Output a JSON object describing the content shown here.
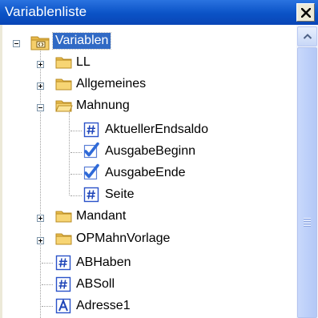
{
  "window": {
    "title": "Variablenliste"
  },
  "tree": {
    "root": {
      "label": "Variablen",
      "expanded": true,
      "selected": true,
      "icon": "folder-struct-icon"
    },
    "items": [
      {
        "label": "LL",
        "icon": "folder-icon",
        "expandable": true,
        "expanded": false,
        "level": 1
      },
      {
        "label": "Allgemeines",
        "icon": "folder-icon",
        "expandable": true,
        "expanded": false,
        "level": 1
      },
      {
        "label": "Mahnung",
        "icon": "folder-open-icon",
        "expandable": true,
        "expanded": true,
        "level": 1
      },
      {
        "label": "AktuellerEndsaldo",
        "icon": "number-icon",
        "expandable": false,
        "level": 2
      },
      {
        "label": "AusgabeBeginn",
        "icon": "checkbox-icon",
        "expandable": false,
        "level": 2
      },
      {
        "label": "AusgabeEnde",
        "icon": "checkbox-icon",
        "expandable": false,
        "level": 2
      },
      {
        "label": "Seite",
        "icon": "number-icon",
        "expandable": false,
        "level": 2
      },
      {
        "label": "Mandant",
        "icon": "folder-icon",
        "expandable": true,
        "expanded": false,
        "level": 1
      },
      {
        "label": "OPMahnVorlage",
        "icon": "folder-icon",
        "expandable": true,
        "expanded": false,
        "level": 1
      },
      {
        "label": "ABHaben",
        "icon": "number-icon",
        "expandable": false,
        "level": 1
      },
      {
        "label": "ABSoll",
        "icon": "number-icon",
        "expandable": false,
        "level": 1
      },
      {
        "label": "Adresse1",
        "icon": "text-icon",
        "expandable": false,
        "level": 1
      }
    ]
  },
  "colors": {
    "titlebar": "#0a52c6",
    "selection": "#316ac5",
    "folder": "#f3c95a",
    "checkmark": "#2f6ad8",
    "number_icon": "#2a52c9"
  }
}
